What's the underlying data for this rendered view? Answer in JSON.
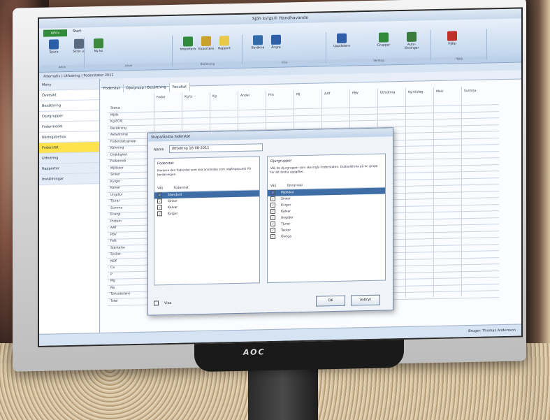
{
  "brand": "AOC",
  "window": {
    "title": "Sjöh kvigs® Handhavande"
  },
  "ribbon": {
    "file_tab": "Arkiv",
    "tabs": [
      "Start"
    ],
    "buttons": [
      {
        "label": "Spara",
        "icon": "save-icon",
        "color": "#2a5ea8"
      },
      {
        "label": "Skriv ut",
        "icon": "print-icon",
        "color": "#5a6b80"
      },
      {
        "label": "Ny ko",
        "icon": "add-animal-icon",
        "color": "#3b8a3b"
      },
      {
        "label": "Importera",
        "icon": "import-icon",
        "color": "#2f8a3a"
      },
      {
        "label": "Exportera",
        "icon": "export-icon",
        "color": "#c8a22a"
      },
      {
        "label": "Rapport",
        "icon": "report-icon",
        "color": "#e8c94a"
      },
      {
        "label": "Beräkna",
        "icon": "calc-icon",
        "color": "#2f6ba8"
      },
      {
        "label": "Ångra",
        "icon": "undo-icon",
        "color": "#2f5ea8"
      },
      {
        "label": "Uppdatera",
        "icon": "refresh-icon",
        "color": "#2f5ea8"
      },
      {
        "label": "Grupper",
        "icon": "groups-icon",
        "color": "#2f8a3a"
      },
      {
        "label": "Auto-lösningar",
        "icon": "auto-icon",
        "color": "#3a7a3a"
      },
      {
        "label": "Hjälp",
        "icon": "help-icon",
        "color": "#c0302a"
      }
    ],
    "groups": [
      "Arkiv",
      "Urval",
      "Beräkning",
      "Visa",
      "Verktyg",
      "Hjälp"
    ]
  },
  "address": "Alternativ  |  Utfodring  |  Foderstater 2011",
  "sidebar": {
    "items": [
      {
        "label": "Meny",
        "state": "group"
      },
      {
        "label": "Översikt",
        "state": ""
      },
      {
        "label": "Besättning",
        "state": ""
      },
      {
        "label": "Djurgrupper",
        "state": ""
      },
      {
        "label": "Fodermedel",
        "state": ""
      },
      {
        "label": "Näringsbehov",
        "state": ""
      },
      {
        "label": "Foderstat",
        "state": "active"
      },
      {
        "label": "Utfodring",
        "state": "group"
      },
      {
        "label": "Rapporter",
        "state": "group"
      },
      {
        "label": "Inställningar",
        "state": "group"
      }
    ]
  },
  "main": {
    "tabs": [
      "Foderstat",
      "Djurgrupp / Besättning",
      "Resultat"
    ],
    "rows": [
      "Status",
      "Mjölk",
      "Kg ECM",
      "Beräkning",
      "Avkastning",
      "Foderstatsgrupp",
      "Kalvning",
      "Dräktighet",
      "Fodernivå",
      "Mjölkkor",
      "Sinkor",
      "Kvigor",
      "Kalvar",
      "Ungdjur",
      "Tjurar",
      "Summa",
      "Energi",
      "Protein",
      "AAT",
      "PBV",
      "Fett",
      "Stärkelse",
      "Socker",
      "NDF",
      "Ca",
      "P",
      "Mg",
      "Na",
      "Torrsubstans",
      "Total"
    ],
    "columns": [
      "Foder",
      "Kg ts",
      "Kg",
      "Andel",
      "Pris",
      "MJ",
      "AAT",
      "PBV",
      "Utfodring",
      "Kg ts/dag",
      "Maxi",
      "Summa"
    ]
  },
  "dialog": {
    "title": "Skapa/Ändra foderstat",
    "name_label": "Namn",
    "name_value": "Utfodring 18-08-2011",
    "left": {
      "title": "Foderstat",
      "desc": "Markera den foderstat som ska användas som utgångspunkt för beräkningen.",
      "head_a": "Välj",
      "head_b": "Foderstat",
      "rows": [
        {
          "label": "Standard",
          "selected": true
        },
        {
          "label": "Sinkor",
          "selected": false
        },
        {
          "label": "Kalvar",
          "selected": false
        },
        {
          "label": "Kvigor",
          "selected": false
        }
      ]
    },
    "right": {
      "title": "Djurgrupper",
      "desc": "Välj de djurgrupper som ska ingå i foderstaten. Dubbelklicka på en grupp för att ändra uppgifter.",
      "head_a": "Välj",
      "head_b": "Djurgrupp",
      "rows": [
        {
          "label": "Mjölkkor",
          "selected": true
        },
        {
          "label": "Sinkor",
          "selected": false
        },
        {
          "label": "Kvigor",
          "selected": false
        },
        {
          "label": "Kalvar",
          "selected": false
        },
        {
          "label": "Ungdjur",
          "selected": false
        },
        {
          "label": "Tjurar",
          "selected": false
        },
        {
          "label": "Tackor",
          "selected": false
        },
        {
          "label": "Övriga",
          "selected": false
        }
      ]
    },
    "checkbox_label": "Visa",
    "ok_label": "OK",
    "cancel_label": "Avbryt"
  },
  "status": {
    "user": "Bruger: Thomas Andersson"
  }
}
